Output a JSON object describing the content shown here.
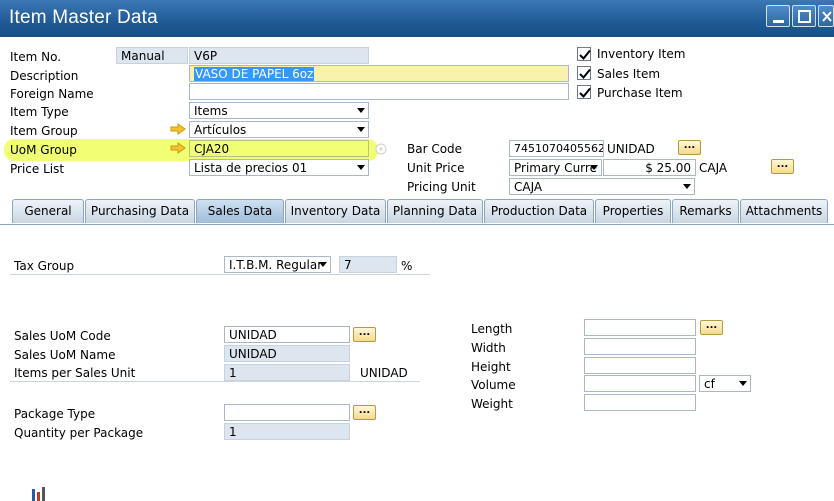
{
  "window": {
    "title": "Item Master Data"
  },
  "header": {
    "item_no_label": "Item No.",
    "item_no_series": "Manual",
    "item_no_value": "V6P",
    "description_label": "Description",
    "description_value": "VASO DE PAPEL 6oz",
    "foreign_name_label": "Foreign Name",
    "foreign_name_value": "",
    "item_type_label": "Item Type",
    "item_type_value": "Items",
    "item_group_label": "Item Group",
    "item_group_value": "Artículos",
    "uom_group_label": "UoM Group",
    "uom_group_value": "CJA20",
    "price_list_label": "Price List",
    "price_list_value": "Lista de precios 01",
    "inventory_item_label": "Inventory Item",
    "sales_item_label": "Sales Item",
    "purchase_item_label": "Purchase Item",
    "inventory_item_checked": true,
    "sales_item_checked": true,
    "purchase_item_checked": true,
    "bar_code_label": "Bar Code",
    "bar_code_value": "7451070405562",
    "bar_code_uom": "UNIDAD",
    "unit_price_label": "Unit Price",
    "unit_price_currency": "Primary Curre",
    "unit_price_value": "$ 25.00",
    "unit_price_uom": "CAJA",
    "pricing_unit_label": "Pricing Unit",
    "pricing_unit_value": "CAJA",
    "ellipsis": "..."
  },
  "tabs": [
    {
      "label": "General"
    },
    {
      "label": "Purchasing Data"
    },
    {
      "label": "Sales Data"
    },
    {
      "label": "Inventory Data"
    },
    {
      "label": "Planning Data"
    },
    {
      "label": "Production Data"
    },
    {
      "label": "Properties"
    },
    {
      "label": "Remarks"
    },
    {
      "label": "Attachments"
    }
  ],
  "sales": {
    "tax_group_label": "Tax Group",
    "tax_group_value": "I.T.B.M. Regular",
    "tax_rate": "7",
    "percent": "%",
    "uom_code_label": "Sales UoM Code",
    "uom_code_value": "UNIDAD",
    "uom_name_label": "Sales UoM Name",
    "uom_name_value": "UNIDAD",
    "items_per_unit_label": "Items per Sales Unit",
    "items_per_unit_value": "1",
    "items_per_unit_uom": "UNIDAD",
    "package_type_label": "Package Type",
    "package_type_value": "",
    "qty_per_package_label": "Quantity per Package",
    "qty_per_package_value": "1",
    "length_label": "Length",
    "width_label": "Width",
    "height_label": "Height",
    "volume_label": "Volume",
    "volume_unit": "cf",
    "weight_label": "Weight"
  }
}
